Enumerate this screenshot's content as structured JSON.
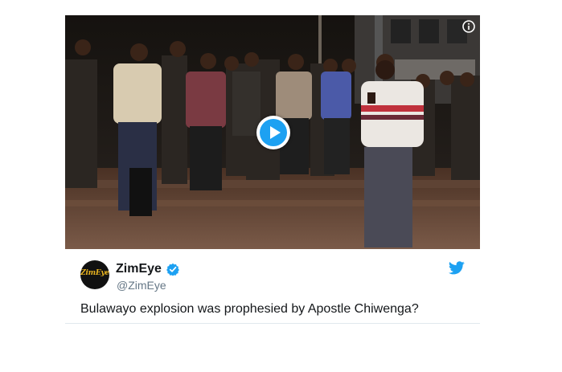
{
  "tweet": {
    "display_name": "ZimEye",
    "handle": "@ZimEye",
    "text": "Bulawayo explosion was prophesied by Apostle Chiwenga?",
    "avatar_text": "ZimEye",
    "verified": true
  },
  "media": {
    "type": "video",
    "controls": [
      "play-button",
      "info-icon"
    ]
  },
  "icons": {
    "brand": "twitter-bird-icon",
    "verified": "verified-badge-icon",
    "info": "info-icon",
    "play": "play-icon"
  },
  "colors": {
    "accent": "#1da1f2",
    "text": "#14171a",
    "muted": "#657786",
    "divider": "#e1e8ed",
    "avatar_bg": "#111111",
    "avatar_text": "#e8b320"
  }
}
